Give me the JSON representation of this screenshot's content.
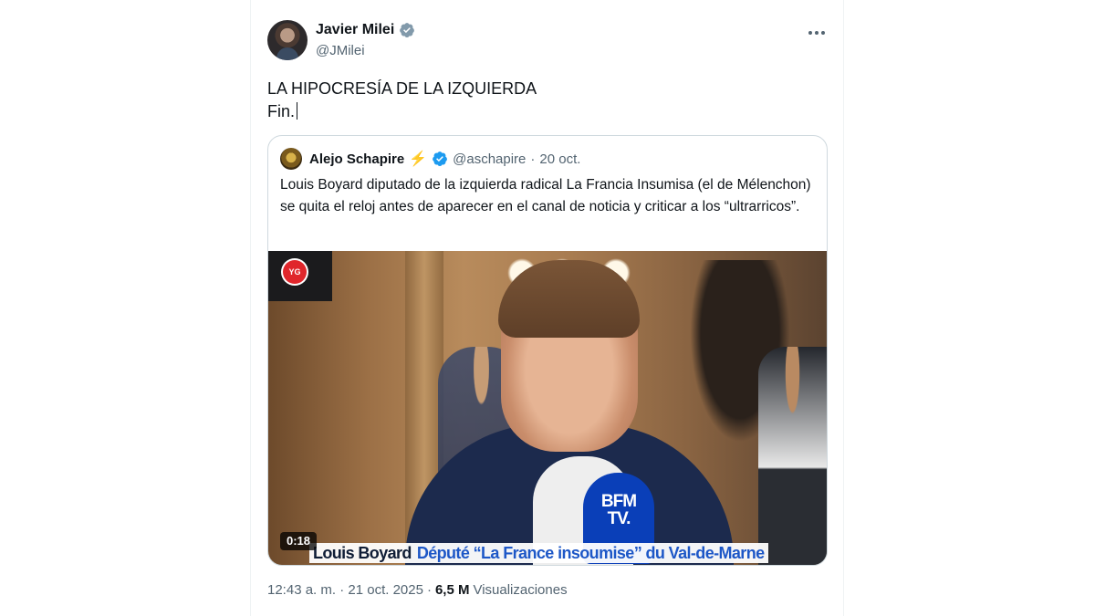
{
  "post": {
    "author": {
      "name": "Javier Milei",
      "handle": "@JMilei",
      "verified_icon": "verified-badge-icon"
    },
    "text_line1": "LA HIPOCRESÍA DE LA IZQUIERDA",
    "text_line2": "Fin.",
    "timestamp": "12:43 a. m. · 21 oct. 2025",
    "separator": "·",
    "views_count": "6,5 M",
    "views_label": "Visualizaciones"
  },
  "quote": {
    "author_name": "Alejo Schapire",
    "emoji": "⚡",
    "handle": "@aschapire",
    "dot": "·",
    "date": "20 oct.",
    "text": "Louis Boyard diputado de la izquierda radical La Francia Insumisa (el de Mélenchon) se quita el reloj antes de aparecer en el canal de noticia y criticar a los “ultrarricos”.",
    "video": {
      "duration": "0:18",
      "channel_logo": "YG",
      "mic_label_1": "BFM",
      "mic_label_2": "TV.",
      "lower_third_name": "Louis Boyard",
      "lower_third_role": "Député “La France insoumise” du Val-de-Marne"
    }
  },
  "colors": {
    "text": "#0f1419",
    "secondary": "#536471",
    "verified": "#1d9bf0",
    "border": "#cfd9de"
  }
}
